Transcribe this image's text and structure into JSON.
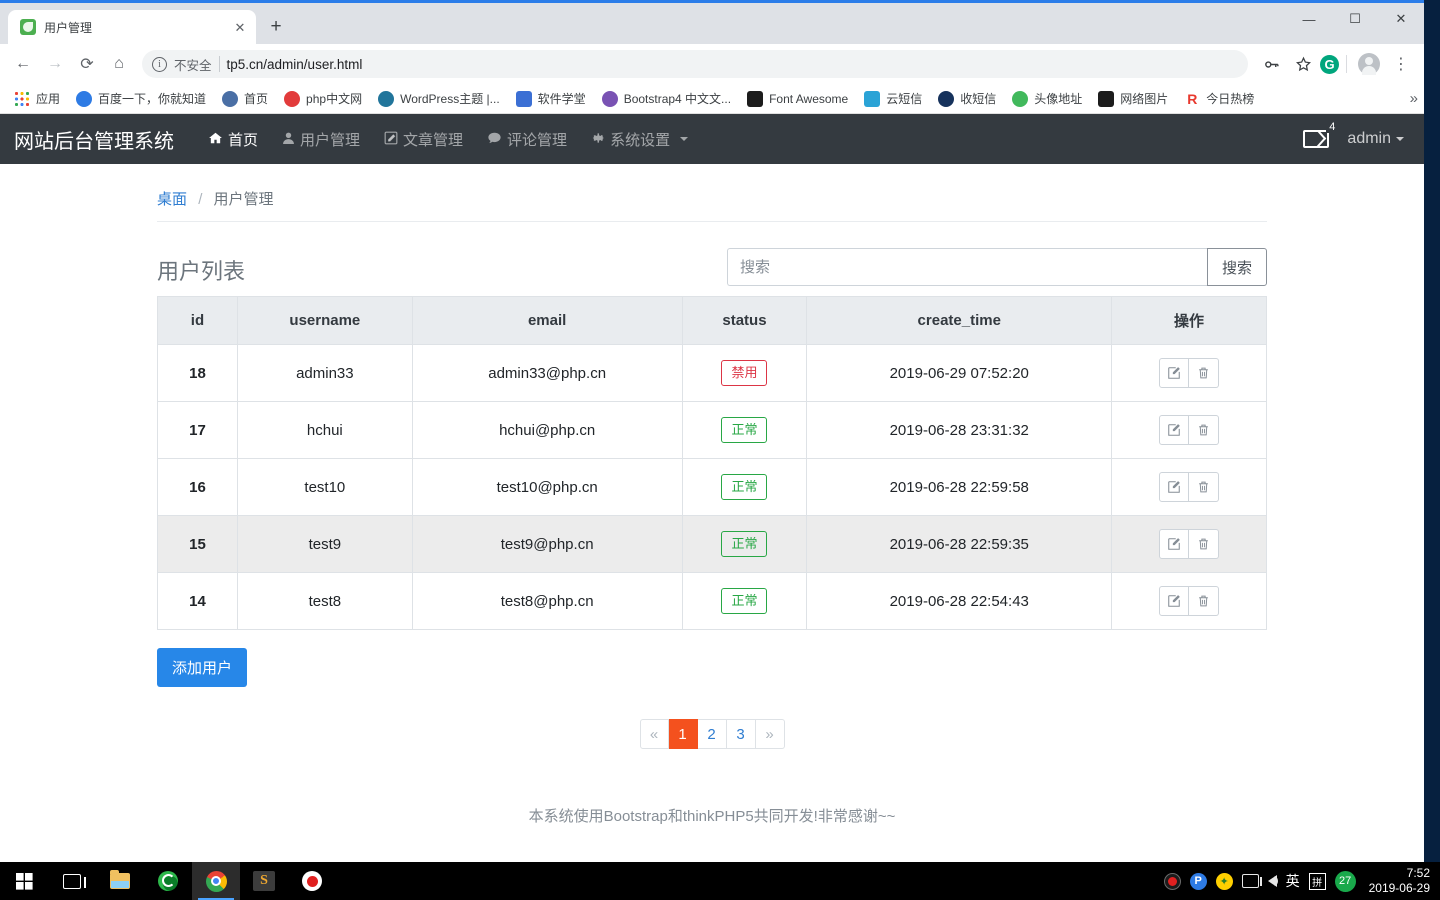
{
  "browser": {
    "tab": {
      "title": "用户管理",
      "favicon": "leaf-icon",
      "close": "✕"
    },
    "new_tab": "+",
    "window_controls": {
      "minimize": "—",
      "maximize": "☐",
      "close": "✕"
    },
    "nav": {
      "back": "←",
      "forward": "→",
      "reload": "⟳",
      "home": "⌂"
    },
    "omnibox": {
      "info": "i",
      "security_label": "不安全",
      "url": "tp5.cn/admin/user.html",
      "key_icon": "key-icon",
      "star_icon": "star-icon",
      "extension_label": "G",
      "menu": "⋮"
    },
    "bookmarks": [
      {
        "label": "应用",
        "icon": "apps-grid-icon"
      },
      {
        "label": "百度一下，你就知道",
        "icon": "baidu-icon"
      },
      {
        "label": "首页",
        "icon": "home-site-icon"
      },
      {
        "label": "php中文网",
        "icon": "php-icon"
      },
      {
        "label": "WordPress主题 |...",
        "icon": "wordpress-icon"
      },
      {
        "label": "软件学堂",
        "icon": "software-school-icon"
      },
      {
        "label": "Bootstrap4 中文文...",
        "icon": "bootstrap-icon"
      },
      {
        "label": "Font Awesome",
        "icon": "font-awesome-icon"
      },
      {
        "label": "云短信",
        "icon": "cloud-sms-icon"
      },
      {
        "label": "收短信",
        "icon": "receive-sms-icon"
      },
      {
        "label": "头像地址",
        "icon": "avatar-url-icon"
      },
      {
        "label": "网络图片",
        "icon": "network-image-icon"
      },
      {
        "label": "今日热榜",
        "icon": "rebang-icon"
      }
    ],
    "bookmarks_overflow": "»"
  },
  "navbar": {
    "brand": "网站后台管理系统",
    "items": [
      {
        "label": "首页",
        "icon": "home-icon",
        "glyph": "⌂",
        "active": true,
        "caret": false
      },
      {
        "label": "用户管理",
        "icon": "user-icon",
        "glyph": "👤",
        "active": false,
        "caret": false
      },
      {
        "label": "文章管理",
        "icon": "edit-icon",
        "glyph": "✎",
        "active": false,
        "caret": false
      },
      {
        "label": "评论管理",
        "icon": "comment-icon",
        "glyph": "💬",
        "active": false,
        "caret": false
      },
      {
        "label": "系统设置",
        "icon": "gear-icon",
        "glyph": "⚙",
        "active": false,
        "caret": true
      }
    ],
    "message_count": "4",
    "user": "admin"
  },
  "breadcrumb": {
    "home": "桌面",
    "separator": "/",
    "current": "用户管理"
  },
  "list": {
    "title": "用户列表",
    "search_placeholder": "搜索",
    "search_value": "",
    "search_button": "搜索",
    "columns": [
      "id",
      "username",
      "email",
      "status",
      "create_time",
      "操作"
    ],
    "rows": [
      {
        "id": "18",
        "username": "admin33",
        "email": "admin33@php.cn",
        "status": "禁用",
        "status_type": "danger",
        "create_time": "2019-06-29 07:52:20",
        "hover": false
      },
      {
        "id": "17",
        "username": "hchui",
        "email": "hchui@php.cn",
        "status": "正常",
        "status_type": "success",
        "create_time": "2019-06-28 23:31:32",
        "hover": false
      },
      {
        "id": "16",
        "username": "test10",
        "email": "test10@php.cn",
        "status": "正常",
        "status_type": "success",
        "create_time": "2019-06-28 22:59:58",
        "hover": false
      },
      {
        "id": "15",
        "username": "test9",
        "email": "test9@php.cn",
        "status": "正常",
        "status_type": "success",
        "create_time": "2019-06-28 22:59:35",
        "hover": true
      },
      {
        "id": "14",
        "username": "test8",
        "email": "test8@php.cn",
        "status": "正常",
        "status_type": "success",
        "create_time": "2019-06-28 22:54:43",
        "hover": false
      }
    ],
    "row_actions": {
      "edit": "edit-icon",
      "delete": "trash-icon"
    },
    "add_button": "添加用户"
  },
  "pagination": {
    "prev": "«",
    "pages": [
      "1",
      "2",
      "3"
    ],
    "active": "1",
    "next": "»"
  },
  "footer": "本系统使用Bootstrap和thinkPHP5共同开发!非常感谢~~",
  "taskbar": {
    "apps": [
      {
        "name": "start-button",
        "icon": "windows-logo-icon"
      },
      {
        "name": "task-view-button",
        "icon": "task-view-icon"
      },
      {
        "name": "file-explorer",
        "icon": "folder-icon"
      },
      {
        "name": "browser-360",
        "icon": "green-browser-icon"
      },
      {
        "name": "chrome",
        "icon": "chrome-icon"
      },
      {
        "name": "sublime-text",
        "icon": "sublime-icon"
      },
      {
        "name": "screen-recorder",
        "icon": "record-icon"
      }
    ],
    "tray": {
      "ime_english": "英",
      "ime_pinyin": "拼",
      "counter": "27"
    },
    "clock_time": "7:52",
    "clock_date": "2019-06-29"
  },
  "colors": {
    "navbar_bg": "#343a40",
    "primary": "#2787e8",
    "pagination_active": "#f4511e",
    "danger": "#dc3545",
    "success": "#28a745",
    "link": "#2f7dd1"
  }
}
